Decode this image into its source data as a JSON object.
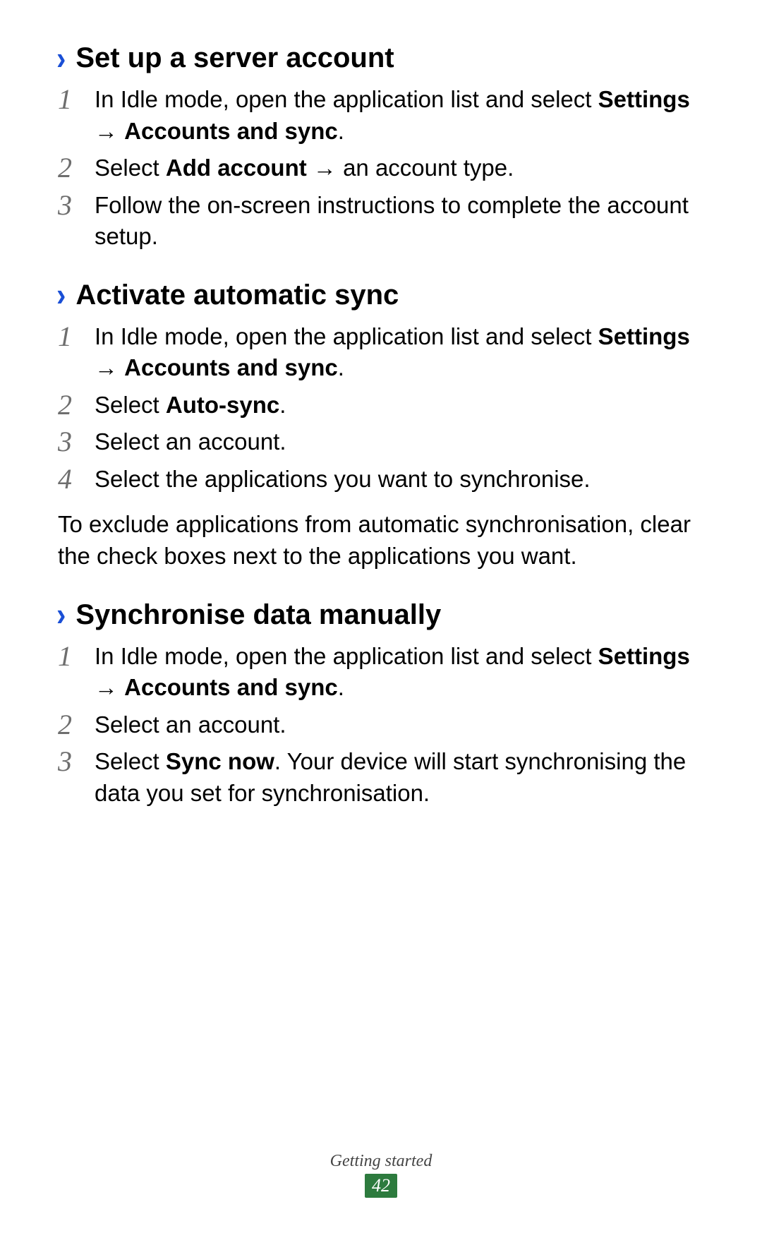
{
  "sections": [
    {
      "title": "Set up a server account",
      "steps": [
        {
          "n": "1",
          "prefix": "In Idle mode, open the application list and select ",
          "bold1": "Settings",
          "arrow": " → ",
          "bold2": "Accounts and sync",
          "suffix": "."
        },
        {
          "n": "2",
          "prefix": "Select ",
          "bold1": "Add account",
          "arrow": " → ",
          "after_arrow": "an account type.",
          "bold2": "",
          "suffix": ""
        },
        {
          "n": "3",
          "plain": "Follow the on-screen instructions to complete the account setup."
        }
      ],
      "note": ""
    },
    {
      "title": "Activate automatic sync",
      "steps": [
        {
          "n": "1",
          "prefix": "In Idle mode, open the application list and select ",
          "bold1": "Settings",
          "arrow": " → ",
          "bold2": "Accounts and sync",
          "suffix": "."
        },
        {
          "n": "2",
          "prefix": "Select ",
          "bold1": "Auto-sync",
          "arrow": "",
          "bold2": "",
          "suffix": "."
        },
        {
          "n": "3",
          "plain": "Select an account."
        },
        {
          "n": "4",
          "plain": "Select the applications you want to synchronise."
        }
      ],
      "note": "To exclude applications from automatic synchronisation, clear the check boxes next to the applications you want."
    },
    {
      "title": "Synchronise data manually",
      "steps": [
        {
          "n": "1",
          "prefix": "In Idle mode, open the application list and select ",
          "bold1": "Settings",
          "arrow": " → ",
          "bold2": "Accounts and sync",
          "suffix": "."
        },
        {
          "n": "2",
          "plain": "Select an account."
        },
        {
          "n": "3",
          "prefix": "Select ",
          "bold1": "Sync now",
          "arrow": "",
          "after_arrow": "",
          "bold2": "",
          "suffix": ". Your device will start synchronising the data you set for synchronisation."
        }
      ],
      "note": ""
    }
  ],
  "footer": {
    "label": "Getting started",
    "page": "42"
  },
  "chevron_glyph": "›"
}
